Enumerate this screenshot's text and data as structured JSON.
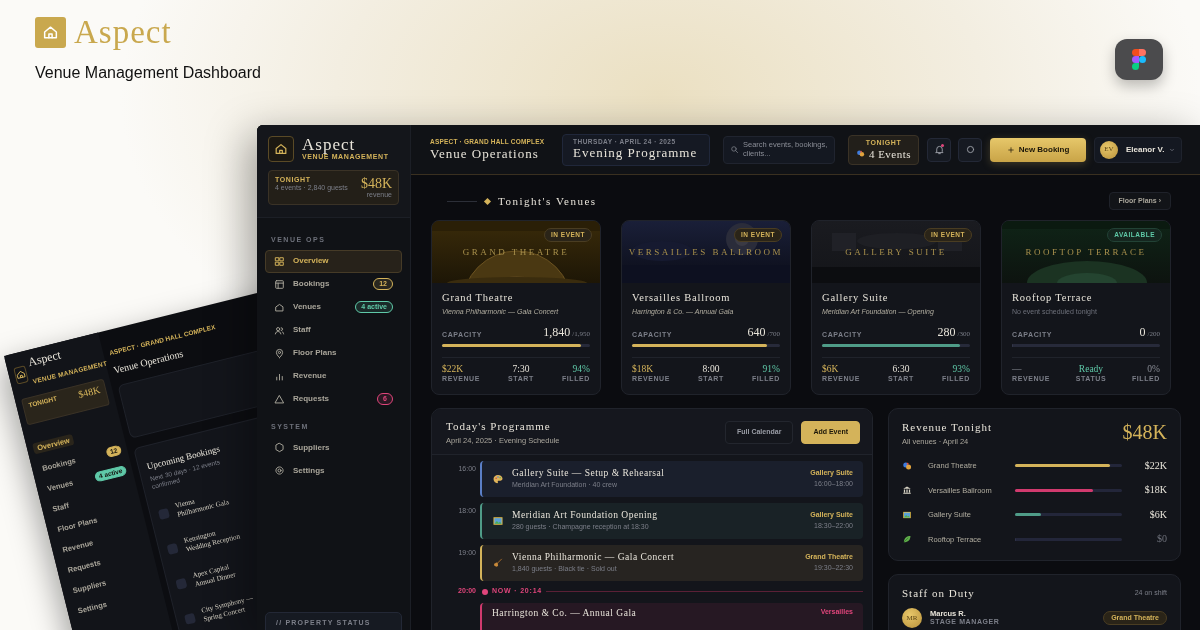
{
  "header": {
    "logo_text": "Aspect",
    "subtitle": "Venue Management Dashboard"
  },
  "back_screen": {
    "brand": "Aspect",
    "brand_subtitle": "VENUE MANAGEMENT",
    "tonight_label": "TONIGHT",
    "tonight_amount": "$48K",
    "nav": [
      {
        "label": "Overview",
        "selected": true
      },
      {
        "label": "Bookings",
        "selected": false,
        "badge": {
          "text": "12",
          "color": "#d4b35a"
        }
      },
      {
        "label": "Venues",
        "selected": false,
        "badge": {
          "text": "4 active",
          "color": "#5fc9a8"
        }
      },
      {
        "label": "Staff",
        "selected": false
      },
      {
        "label": "Floor Plans",
        "selected": false
      },
      {
        "label": "Revenue",
        "selected": false
      },
      {
        "label": "Requests",
        "selected": false
      },
      {
        "label": "Suppliers",
        "selected": false
      },
      {
        "label": "Settings",
        "selected": false
      }
    ],
    "eyebrow": "ASPECT · GRAND HALL COMPLEX",
    "title": "Venue Operations",
    "bookings": {
      "title": "Upcoming Bookings",
      "subtitle": "Next 30 days · 12 events confirmed",
      "items": [
        "Vienna Philharmonic Gala",
        "Kensington Wedding Reception",
        "Apex Capital Annual Dinner",
        "City Symphony — Spring Concert"
      ]
    }
  },
  "sidebar": {
    "brand": "Aspect",
    "brand_subtitle": "VENUE MANAGEMENT",
    "tonight": {
      "label": "TONIGHT",
      "detail": "4 events · 2,840 guests",
      "amount": "$48K",
      "unit": "revenue"
    },
    "sections": [
      {
        "title": "VENUE OPS",
        "items": [
          {
            "label": "Overview",
            "selected": true
          },
          {
            "label": "Bookings",
            "selected": false,
            "badge": {
              "text": "12",
              "color": "#d4b35a"
            }
          },
          {
            "label": "Venues",
            "selected": false,
            "badge": {
              "text": "4 active",
              "color": "#5fc9a8"
            }
          },
          {
            "label": "Staff",
            "selected": false
          },
          {
            "label": "Floor Plans",
            "selected": false
          },
          {
            "label": "Revenue",
            "selected": false
          },
          {
            "label": "Requests",
            "selected": false,
            "badge": {
              "text": "6",
              "color": "#e0457b"
            }
          }
        ]
      },
      {
        "title": "SYSTEM",
        "items": [
          {
            "label": "Suppliers",
            "selected": false
          },
          {
            "label": "Settings",
            "selected": false
          }
        ]
      }
    ],
    "footer": "// PROPERTY STATUS"
  },
  "topbar": {
    "eyebrow": "ASPECT · GRAND HALL COMPLEX",
    "title": "Venue Operations",
    "date": {
      "label": "THURSDAY · APRIL 24 · 2025",
      "title": "Evening Programme"
    },
    "search": {
      "placeholder": "Search events, bookings, clients..."
    },
    "tonight": {
      "label": "TONIGHT",
      "value": "4 Events"
    },
    "notifications": {
      "unread": true
    },
    "new_booking": "New Booking",
    "user": {
      "initials": "EV",
      "name": "Eleanor V."
    }
  },
  "venues": {
    "title": "Tonight's Venues",
    "action": "Floor Plans ›",
    "cards": [
      {
        "banner": "GRAND THEATRE",
        "name": "Grand Theatre",
        "status": {
          "kind": "in_event",
          "label": "IN EVENT"
        },
        "event": "Vienna Philharmonic — Gala Concert",
        "capacity_label": "CAPACITY",
        "count": "1,840",
        "total": "/1,950",
        "level": 0.94,
        "color": "#d4b35a",
        "stats": [
          {
            "kind": "revenue",
            "value": "$22K",
            "label": "REVENUE"
          },
          {
            "kind": "start",
            "value": "7:30",
            "label": "START"
          },
          {
            "kind": "filled",
            "value": "94%",
            "label": "FILLED"
          }
        ]
      },
      {
        "banner": "VERSAILLES BALLROOM",
        "name": "Versailles Ballroom",
        "status": {
          "kind": "in_event",
          "label": "IN EVENT"
        },
        "event": "Harrington & Co. — Annual Gala",
        "capacity_label": "CAPACITY",
        "count": "640",
        "total": "/700",
        "level": 0.91,
        "color": "#d4b35a",
        "stats": [
          {
            "kind": "revenue",
            "value": "$18K",
            "label": "REVENUE"
          },
          {
            "kind": "start",
            "value": "8:00",
            "label": "START"
          },
          {
            "kind": "filled",
            "value": "91%",
            "label": "FILLED"
          }
        ]
      },
      {
        "banner": "GALLERY SUITE",
        "name": "Gallery Suite",
        "status": {
          "kind": "in_event",
          "label": "IN EVENT"
        },
        "event": "Meridian Art Foundation — Opening",
        "capacity_label": "CAPACITY",
        "count": "280",
        "total": "/300",
        "level": 0.93,
        "color": "#4f9c88",
        "stats": [
          {
            "kind": "revenue",
            "value": "$6K",
            "label": "REVENUE"
          },
          {
            "kind": "start",
            "value": "6:30",
            "label": "START"
          },
          {
            "kind": "filled",
            "value": "93%",
            "label": "FILLED"
          }
        ]
      },
      {
        "banner": "ROOFTOP TERRACE",
        "name": "Rooftop Terrace",
        "status": {
          "kind": "available",
          "label": "AVAILABLE"
        },
        "event": "No event scheduled tonight",
        "capacity_label": "CAPACITY",
        "count": "0",
        "total": "/200",
        "level": 0,
        "stats": [
          {
            "kind": "none",
            "value": "—",
            "label": "REVENUE"
          },
          {
            "kind": "status",
            "value": "Ready",
            "label": "STATUS"
          },
          {
            "kind": "none",
            "value": "0%",
            "label": "FILLED"
          }
        ]
      }
    ]
  },
  "programme": {
    "title": "Today's Programme",
    "subtitle": "April 24, 2025 · Evening Schedule",
    "actions": [
      {
        "kind": "secondary",
        "label": "Full Calendar"
      },
      {
        "kind": "primary",
        "label": "Add Event"
      }
    ],
    "timeline": [
      {
        "kind": "rehearsal",
        "time": "16:00",
        "title": "Gallery Suite — Setup & Rehearsal",
        "detail": "Meridian Art Foundation · 40 crew",
        "venue": "Gallery Suite",
        "range": "16:00–18:00",
        "color": "#5b7fc7",
        "live": false
      },
      {
        "kind": "exhibition",
        "time": "18:00",
        "title": "Meridian Art Foundation Opening",
        "detail": "280 guests · Champagne reception at 18:30",
        "venue": "Gallery Suite",
        "range": "18:30–22:00",
        "color": "#4f9c88",
        "live": false
      },
      {
        "kind": "concert",
        "time": "19:00",
        "title": "Vienna Philharmonic — Gala Concert",
        "detail": "1,840 guests · Black tie · Sold out",
        "venue": "Grand Theatre",
        "range": "19:30–22:30",
        "color": "#d4b35a",
        "live": false
      },
      {
        "kind": "now",
        "time": "20:00",
        "label": "NOW · 20:14"
      },
      {
        "kind": "gala",
        "title": "Harrington & Co. — Annual Gala",
        "venue": "Versailles",
        "color": "#d13a6e",
        "live": true
      }
    ]
  },
  "revenue": {
    "title": "Revenue Tonight",
    "subtitle": "All venues · April 24",
    "total": "$48K",
    "rows": [
      {
        "kind": "theatre",
        "name": "Grand Theatre",
        "level": 0.89,
        "value": "$22K",
        "color": "#d4b35a"
      },
      {
        "kind": "ballroom",
        "name": "Versailles Ballroom",
        "level": 0.73,
        "value": "$18K",
        "color": "#d13a6e"
      },
      {
        "kind": "gallery",
        "name": "Gallery Suite",
        "level": 0.24,
        "value": "$6K",
        "color": "#4f9c88"
      },
      {
        "kind": "terrace",
        "name": "Rooftop Terrace",
        "level": 0,
        "value": "$0"
      }
    ]
  },
  "staff": {
    "title": "Staff on Duty",
    "count": "24 on shift",
    "members": [
      {
        "initials": "MR",
        "name": "Marcus R.",
        "role": "STAGE MANAGER",
        "venue": "Grand Theatre"
      }
    ]
  }
}
